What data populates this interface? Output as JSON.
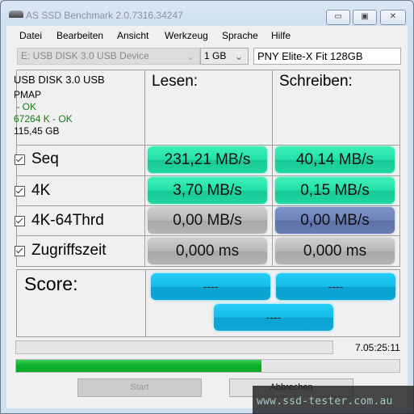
{
  "window": {
    "title": "AS SSD Benchmark 2.0.7316.34247",
    "controls": {
      "minimize": "▭",
      "maximize": "▣",
      "close": "✕"
    }
  },
  "menu": [
    "Datei",
    "Bearbeiten",
    "Ansicht",
    "Werkzeug",
    "Sprache",
    "Hilfe"
  ],
  "toolbar": {
    "device": "E: USB DISK 3.0 USB Device",
    "size": "1 GB",
    "name": "PNY Elite-X Fit 128GB"
  },
  "device_info": {
    "model": "USB DISK 3.0 USB",
    "driver": "PMAP",
    "driver_status": " - OK",
    "alignment": "67264 K - OK",
    "capacity": "115,45 GB"
  },
  "headers": {
    "read": "Lesen:",
    "write": "Schreiben:"
  },
  "rows": [
    {
      "label": "Seq",
      "checked": true,
      "read": "231,21 MB/s",
      "write": "40,14 MB/s"
    },
    {
      "label": "4K",
      "checked": true,
      "read": "3,70 MB/s",
      "write": "0,15 MB/s"
    },
    {
      "label": "4K-64Thrd",
      "checked": true,
      "read": "0,00 MB/s",
      "write": "0,00 MB/s"
    },
    {
      "label": "Zugriffszeit",
      "checked": true,
      "read": "0,000 ms",
      "write": "0,000 ms"
    }
  ],
  "score": {
    "label": "Score:",
    "read": "----",
    "write": "----",
    "total": "----"
  },
  "status": {
    "elapsed": "7.05:25:11",
    "progress_percent": 64
  },
  "buttons": {
    "start": "Start",
    "abort": "Abbrechen"
  },
  "watermark": "www.ssd-tester.com.au",
  "colors": {
    "good": "#22e0a8",
    "idle": "#b8b8b8",
    "active": "#6f83bb",
    "score": "#14bdea",
    "progress": "#06aa27"
  }
}
